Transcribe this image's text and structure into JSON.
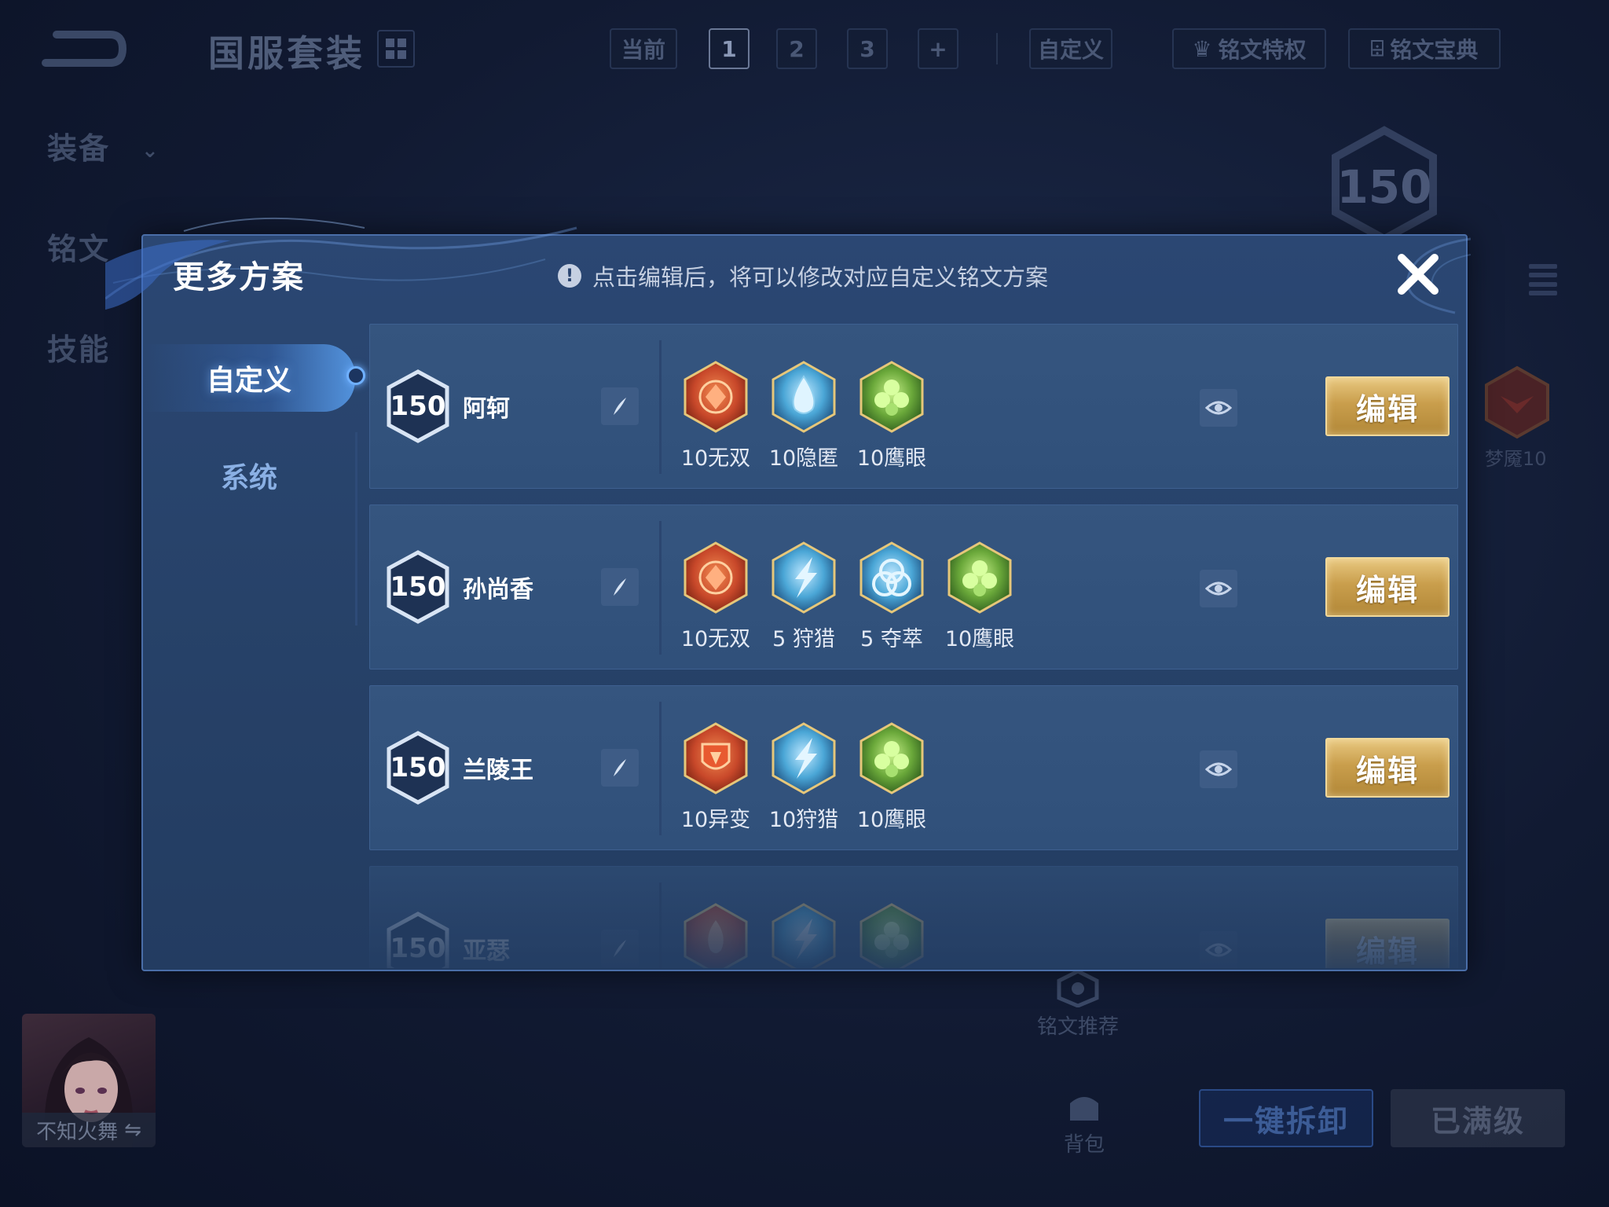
{
  "background": {
    "suite_title": "国服套装",
    "tabs_row": [
      {
        "label": "当前",
        "active": false
      },
      {
        "label": "1",
        "active": true
      },
      {
        "label": "2",
        "active": false
      },
      {
        "label": "3",
        "active": false
      },
      {
        "label": "+",
        "active": false
      }
    ],
    "custom_label": "自定义",
    "privilege_label": "铭文特权",
    "codex_label": "铭文宝典",
    "side_nav": [
      "装备",
      "铭文",
      "技能"
    ],
    "level_value": "150",
    "rune_hint_label": "梦魇10",
    "recommend_label": "铭文推荐",
    "bag_label": "背包",
    "uninstall_label": "一键拆卸",
    "full_label": "已满级",
    "player_name": "不知火舞",
    "switch_icon": "⇋"
  },
  "modal": {
    "title": "更多方案",
    "hint": "点击编辑后，将可以修改对应自定义铭文方案",
    "hint_icon": "!",
    "tabs": [
      {
        "label": "自定义",
        "active": true
      },
      {
        "label": "系统",
        "active": false
      }
    ],
    "edit_label": "编辑",
    "rows": [
      {
        "level": "150",
        "hero": "阿轲",
        "runes": [
          {
            "kind": "red-rose",
            "label": "10无双"
          },
          {
            "kind": "blue-drop",
            "label": "10隐匿"
          },
          {
            "kind": "green-clover",
            "label": "10鹰眼"
          }
        ]
      },
      {
        "level": "150",
        "hero": "孙尚香",
        "runes": [
          {
            "kind": "red-rose",
            "label": "10无双"
          },
          {
            "kind": "blue-bolt",
            "label": "5 狩猎"
          },
          {
            "kind": "blue-knot",
            "label": "5 夺萃"
          },
          {
            "kind": "green-clover",
            "label": "10鹰眼"
          }
        ]
      },
      {
        "level": "150",
        "hero": "兰陵王",
        "runes": [
          {
            "kind": "red-shield",
            "label": "10异变"
          },
          {
            "kind": "blue-bolt",
            "label": "10狩猎"
          },
          {
            "kind": "green-clover",
            "label": "10鹰眼"
          }
        ]
      },
      {
        "level": "150",
        "hero": "亚瑟",
        "runes": [
          {
            "kind": "red-flame",
            "label": ""
          },
          {
            "kind": "blue-bolt",
            "label": ""
          },
          {
            "kind": "green-clover",
            "label": ""
          }
        ]
      }
    ]
  },
  "colors": {
    "background": "#111a32",
    "modal": "#274269",
    "row": "#35557f",
    "gold": "#c99e4c",
    "rune_red": "#c8482a",
    "rune_blue": "#4aa6d6",
    "rune_green": "#6aa83a"
  }
}
